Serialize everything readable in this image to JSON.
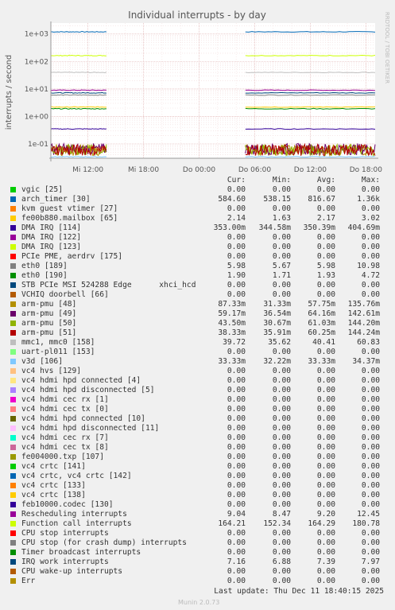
{
  "chart_data": {
    "type": "line",
    "title": "Individual interrupts - by day",
    "ylabel": "interrupts / second",
    "y_scale": "log",
    "ylim": [
      0.03,
      2500
    ],
    "y_ticks": [
      "1e+03",
      "1e+02",
      "1e+01",
      "1e+00",
      "1e-01"
    ],
    "x_ticks": [
      "Mi 12:00",
      "Mi 18:00",
      "Do 00:00",
      "Do 06:00",
      "Do 12:00",
      "Do 18:00"
    ],
    "gap": "Wed 14:00 – Thu 05:00 no data",
    "side_label": "RRDTOOL / TOBI OETIKER",
    "columns": [
      "Cur:",
      "Min:",
      "Avg:",
      "Max:"
    ],
    "series": [
      {
        "name": "vgic [25]",
        "color": "#00cc00",
        "cur": "0.00",
        "min": "0.00",
        "avg": "0.00",
        "max": "0.00"
      },
      {
        "name": "arch_timer [30]",
        "color": "#0066b3",
        "cur": "584.60",
        "min": "538.15",
        "avg": "816.67",
        "max": "1.36k"
      },
      {
        "name": "kvm guest vtimer [27]",
        "color": "#ff8000",
        "cur": "0.00",
        "min": "0.00",
        "avg": "0.00",
        "max": "0.00"
      },
      {
        "name": "fe00b880.mailbox [65]",
        "color": "#ffcc00",
        "cur": "2.14",
        "min": "1.63",
        "avg": "2.17",
        "max": "3.02"
      },
      {
        "name": "DMA IRQ [114]",
        "color": "#330099",
        "cur": "353.00m",
        "min": "344.58m",
        "avg": "350.39m",
        "max": "404.69m"
      },
      {
        "name": "DMA IRQ [122]",
        "color": "#990099",
        "cur": "0.00",
        "min": "0.00",
        "avg": "0.00",
        "max": "0.00"
      },
      {
        "name": "DMA IRQ [123]",
        "color": "#ccff00",
        "cur": "0.00",
        "min": "0.00",
        "avg": "0.00",
        "max": "0.00"
      },
      {
        "name": "PCIe PME, aerdrv [175]",
        "color": "#ff0000",
        "cur": "0.00",
        "min": "0.00",
        "avg": "0.00",
        "max": "0.00"
      },
      {
        "name": "eth0 [189]",
        "color": "#808080",
        "cur": "5.98",
        "min": "5.67",
        "avg": "5.98",
        "max": "10.98"
      },
      {
        "name": "eth0 [190]",
        "color": "#008f00",
        "cur": "1.90",
        "min": "1.71",
        "avg": "1.93",
        "max": "4.72"
      },
      {
        "name": "STB PCIe MSI 524288 Edge      xhci_hcd",
        "color": "#00487d",
        "cur": "0.00",
        "min": "0.00",
        "avg": "0.00",
        "max": "0.00"
      },
      {
        "name": "VCHIQ doorbell [66]",
        "color": "#b35a00",
        "cur": "0.00",
        "min": "0.00",
        "avg": "0.00",
        "max": "0.00"
      },
      {
        "name": "arm-pmu [48]",
        "color": "#b38f00",
        "cur": "87.33m",
        "min": "31.33m",
        "avg": "57.75m",
        "max": "135.76m"
      },
      {
        "name": "arm-pmu [49]",
        "color": "#6b006b",
        "cur": "59.17m",
        "min": "36.54m",
        "avg": "64.16m",
        "max": "142.61m"
      },
      {
        "name": "arm-pmu [50]",
        "color": "#8fb300",
        "cur": "43.50m",
        "min": "30.67m",
        "avg": "61.03m",
        "max": "144.20m"
      },
      {
        "name": "arm-pmu [51]",
        "color": "#b30000",
        "cur": "38.33m",
        "min": "35.91m",
        "avg": "60.25m",
        "max": "144.24m"
      },
      {
        "name": "mmc1, mmc0 [158]",
        "color": "#bebebe",
        "cur": "39.72",
        "min": "35.62",
        "avg": "40.41",
        "max": "60.83"
      },
      {
        "name": "uart-pl011 [153]",
        "color": "#80ff80",
        "cur": "0.00",
        "min": "0.00",
        "avg": "0.00",
        "max": "0.00"
      },
      {
        "name": "v3d [106]",
        "color": "#80c9ff",
        "cur": "33.33m",
        "min": "32.22m",
        "avg": "33.33m",
        "max": "34.37m"
      },
      {
        "name": "vc4 hvs [129]",
        "color": "#ffc080",
        "cur": "0.00",
        "min": "0.00",
        "avg": "0.00",
        "max": "0.00"
      },
      {
        "name": "vc4 hdmi hpd connected [4]",
        "color": "#ffe680",
        "cur": "0.00",
        "min": "0.00",
        "avg": "0.00",
        "max": "0.00"
      },
      {
        "name": "vc4 hdmi hpd disconnected [5]",
        "color": "#aa80ff",
        "cur": "0.00",
        "min": "0.00",
        "avg": "0.00",
        "max": "0.00"
      },
      {
        "name": "vc4 hdmi cec rx [1]",
        "color": "#ee00cc",
        "cur": "0.00",
        "min": "0.00",
        "avg": "0.00",
        "max": "0.00"
      },
      {
        "name": "vc4 hdmi cec tx [0]",
        "color": "#ff8080",
        "cur": "0.00",
        "min": "0.00",
        "avg": "0.00",
        "max": "0.00"
      },
      {
        "name": "vc4 hdmi hpd connected [10]",
        "color": "#666600",
        "cur": "0.00",
        "min": "0.00",
        "avg": "0.00",
        "max": "0.00"
      },
      {
        "name": "vc4 hdmi hpd disconnected [11]",
        "color": "#ffbfff",
        "cur": "0.00",
        "min": "0.00",
        "avg": "0.00",
        "max": "0.00"
      },
      {
        "name": "vc4 hdmi cec rx [7]",
        "color": "#00ffcc",
        "cur": "0.00",
        "min": "0.00",
        "avg": "0.00",
        "max": "0.00"
      },
      {
        "name": "vc4 hdmi cec tx [8]",
        "color": "#cc6699",
        "cur": "0.00",
        "min": "0.00",
        "avg": "0.00",
        "max": "0.00"
      },
      {
        "name": "fe004000.txp [107]",
        "color": "#999900",
        "cur": "0.00",
        "min": "0.00",
        "avg": "0.00",
        "max": "0.00"
      },
      {
        "name": "vc4 crtc [141]",
        "color": "#00cc00",
        "cur": "0.00",
        "min": "0.00",
        "avg": "0.00",
        "max": "0.00"
      },
      {
        "name": "vc4 crtc, vc4 crtc [142]",
        "color": "#0066b3",
        "cur": "0.00",
        "min": "0.00",
        "avg": "0.00",
        "max": "0.00"
      },
      {
        "name": "vc4 crtc [133]",
        "color": "#ff8000",
        "cur": "0.00",
        "min": "0.00",
        "avg": "0.00",
        "max": "0.00"
      },
      {
        "name": "vc4 crtc [138]",
        "color": "#ffcc00",
        "cur": "0.00",
        "min": "0.00",
        "avg": "0.00",
        "max": "0.00"
      },
      {
        "name": "feb10000.codec [130]",
        "color": "#330099",
        "cur": "0.00",
        "min": "0.00",
        "avg": "0.00",
        "max": "0.00"
      },
      {
        "name": "Rescheduling interrupts",
        "color": "#990099",
        "cur": "9.04",
        "min": "8.47",
        "avg": "9.20",
        "max": "12.45"
      },
      {
        "name": "Function call interrupts",
        "color": "#ccff00",
        "cur": "164.21",
        "min": "152.34",
        "avg": "164.29",
        "max": "180.78"
      },
      {
        "name": "CPU stop interrupts",
        "color": "#ff0000",
        "cur": "0.00",
        "min": "0.00",
        "avg": "0.00",
        "max": "0.00"
      },
      {
        "name": "CPU stop (for crash dump) interrupts",
        "color": "#808080",
        "cur": "0.00",
        "min": "0.00",
        "avg": "0.00",
        "max": "0.00"
      },
      {
        "name": "Timer broadcast interrupts",
        "color": "#008f00",
        "cur": "0.00",
        "min": "0.00",
        "avg": "0.00",
        "max": "0.00"
      },
      {
        "name": "IRQ work interrupts",
        "color": "#00487d",
        "cur": "7.16",
        "min": "6.88",
        "avg": "7.39",
        "max": "7.97"
      },
      {
        "name": "CPU wake-up interrupts",
        "color": "#b35a00",
        "cur": "0.00",
        "min": "0.00",
        "avg": "0.00",
        "max": "0.00"
      },
      {
        "name": "Err",
        "color": "#b38f00",
        "cur": "0.00",
        "min": "0.00",
        "avg": "0.00",
        "max": "0.00"
      }
    ],
    "plotted_levels": [
      {
        "color": "#0066b3",
        "value": 1200
      },
      {
        "color": "#ccff00",
        "value": 164
      },
      {
        "color": "#bebebe",
        "value": 40
      },
      {
        "color": "#990099",
        "value": 9
      },
      {
        "color": "#00487d",
        "value": 7.2
      },
      {
        "color": "#808080",
        "value": 6
      },
      {
        "color": "#ffcc00",
        "value": 2.2
      },
      {
        "color": "#008f00",
        "value": 1.9
      },
      {
        "color": "#330099",
        "value": 0.35
      },
      {
        "color": "#80c9ff",
        "value": 0.034
      },
      {
        "color": "#b38f00",
        "value": 0.06
      },
      {
        "color": "#6b006b",
        "value": 0.065
      },
      {
        "color": "#8fb300",
        "value": 0.06
      },
      {
        "color": "#b30000",
        "value": 0.06
      }
    ]
  },
  "footer": {
    "last_update": "Last update: Thu Dec 11 18:40:15 2025",
    "munin": "Munin 2.0.73"
  }
}
